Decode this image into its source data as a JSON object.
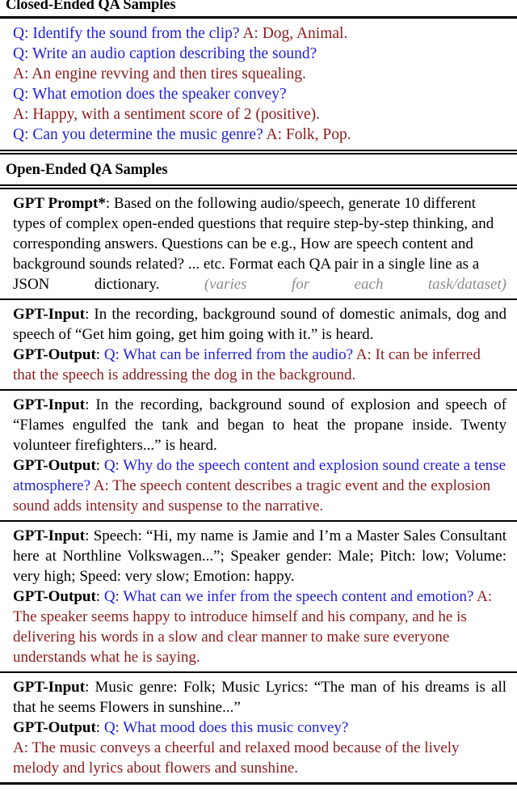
{
  "closed_section": {
    "title": "Closed-Ended QA Samples",
    "lines": [
      {
        "q": "Q: Identify the sound from the clip?",
        "a": "A: Dog, Animal."
      },
      {
        "q": "Q: Write an audio caption describing the sound?",
        "a": ""
      },
      {
        "q": "",
        "a": "A: An engine revving and then tires squealing."
      },
      {
        "q": "Q: What emotion does the speaker convey?",
        "a": ""
      },
      {
        "q": "",
        "a": "A: Happy, with a sentiment score of 2 (positive)."
      },
      {
        "q": "Q: Can you determine the music genre?",
        "a": "A: Folk, Pop."
      }
    ]
  },
  "open_section": {
    "title": "Open-Ended QA Samples",
    "prompt_block": {
      "label": "GPT Prompt*",
      "colon": ": ",
      "text": "Based on the following audio/speech, generate 10 different types of complex open-ended questions that require step-by-step thinking, and corresponding answers. Questions can be e.g., How are speech content and background sounds related? ... etc. Format each QA pair in a single line as a JSON dictionary.",
      "note": " (varies for each task/dataset)"
    },
    "examples": [
      {
        "input_label": "GPT-Input",
        "input_text": ": In the recording, background sound of domestic animals, dog and speech of “Get him going, get him going with it.” is heard.",
        "output_label": "GPT-Output",
        "output_colon": ": ",
        "output_q": "Q: What can be inferred from the audio?",
        "output_a": " A: It can be inferred that the speech is addressing the dog in the background."
      },
      {
        "input_label": "GPT-Input",
        "input_text": ": In the recording, background sound of explosion and speech of “Flames engulfed the tank and began to heat the propane inside. Twenty volunteer firefighters...” is heard.",
        "output_label": "GPT-Output",
        "output_colon": ": ",
        "output_q": "Q: Why do the speech content and explosion sound create a tense atmosphere?",
        "output_a": " A: The speech content describes a tragic event and the explosion sound adds intensity and suspense to the narrative."
      },
      {
        "input_label": "GPT-Input",
        "input_text": ": Speech: “Hi, my name is Jamie and I’m a Master Sales Consultant here at Northline Volkswagen...”; Speaker gender: Male; Pitch: low; Volume: very high; Speed: very slow; Emotion: happy.",
        "output_label": "GPT-Output",
        "output_colon": ": ",
        "output_q": "Q: What can we infer from the speech content and emotion?",
        "output_a": " A: The speaker seems happy to introduce himself and his company, and he is delivering his words in a slow and clear manner to make sure everyone understands what he is saying."
      },
      {
        "input_label": "GPT-Input",
        "input_text": ": Music genre: Folk; Music Lyrics: “The man of his dreams is all that he seems Flowers in sunshine...”",
        "output_label": "GPT-Output",
        "output_colon": ": ",
        "output_q": "Q: What mood does this music convey?",
        "output_a": "A: The music conveys a cheerful and relaxed mood because of the lively melody and lyrics about flowers and sunshine."
      }
    ]
  },
  "colors": {
    "question_blue": "#2020dd",
    "answer_maroon": "#8b1a1a",
    "note_gray": "#8c8c8c",
    "body_black": "#000000"
  }
}
